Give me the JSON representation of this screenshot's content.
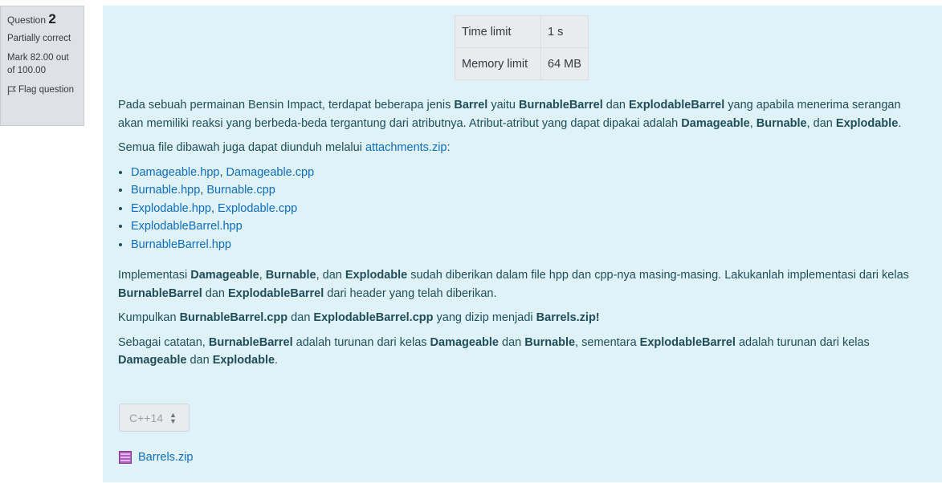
{
  "question_info": {
    "question_label": "Question",
    "question_number": "2",
    "state": "Partially correct",
    "grade": "Mark 82.00 out of 100.00",
    "flag_label": "Flag question"
  },
  "limits": {
    "time_label": "Time limit",
    "time_value": "1 s",
    "memory_label": "Memory limit",
    "memory_value": "64 MB"
  },
  "description": {
    "p1": {
      "t1": "Pada sebuah permainan Bensin Impact, terdapat beberapa jenis ",
      "b1": "Barrel",
      "t2": " yaitu ",
      "b2": "BurnableBarrel",
      "t3": " dan ",
      "b3": "ExplodableBarrel",
      "t4": " yang apabila menerima serangan akan memiliki reaksi yang berbeda-beda tergantung dari atributnya. Atribut-atribut yang dapat dipakai adalah ",
      "b4": "Damageable",
      "t5": ", ",
      "b5": "Burnable",
      "t6": ", dan ",
      "b6": "Explodable",
      "t7": "."
    },
    "p2": {
      "t1": "Semua file dibawah juga dapat diunduh melalui ",
      "link": "attachments.zip",
      "t2": ":"
    },
    "files": [
      {
        "a": "Damageable.hpp",
        "sep": ", ",
        "b": "Damageable.cpp"
      },
      {
        "a": "Burnable.hpp",
        "sep": ", ",
        "b": "Burnable.cpp"
      },
      {
        "a": "Explodable.hpp",
        "sep": ", ",
        "b": "Explodable.cpp"
      },
      {
        "a": "ExplodableBarrel.hpp"
      },
      {
        "a": "BurnableBarrel.hpp"
      }
    ],
    "p3": {
      "t1": "Implementasi ",
      "b1": "Damageable",
      "t2": ", ",
      "b2": "Burnable",
      "t3": ", dan ",
      "b3": "Explodable",
      "t4": " sudah diberikan dalam file hpp dan cpp-nya masing-masing. Lakukanlah implementasi dari kelas ",
      "b4": "BurnableBarrel",
      "t5": " dan ",
      "b5": "ExplodableBarrel",
      "t6": " dari header yang telah diberikan."
    },
    "p4": {
      "t1": "Kumpulkan ",
      "b1": "BurnableBarrel.cpp",
      "t2": " dan ",
      "b2": "ExplodableBarrel.cpp",
      "t3": " yang dizip menjadi ",
      "b3": "Barrels.zip!"
    },
    "p5": {
      "t1": "Sebagai catatan, ",
      "b1": "BurnableBarrel",
      "t2": " adalah turunan dari kelas ",
      "b2": "Damageable",
      "t3": " dan ",
      "b3": "Burnable",
      "t4": ", sementara ",
      "b4": "ExplodableBarrel",
      "t5": " adalah turunan dari kelas ",
      "b5": "Damageable",
      "t6": " dan ",
      "b6": "Explodable",
      "t7": "."
    }
  },
  "language_select": {
    "value": "C++14"
  },
  "attachment": {
    "name": "Barrels.zip",
    "icon": "archive-icon"
  },
  "colors": {
    "content_bg": "#def2f8",
    "info_bg": "#dee2e6",
    "link": "#0f6cbf",
    "text": "#1f4e5a"
  }
}
